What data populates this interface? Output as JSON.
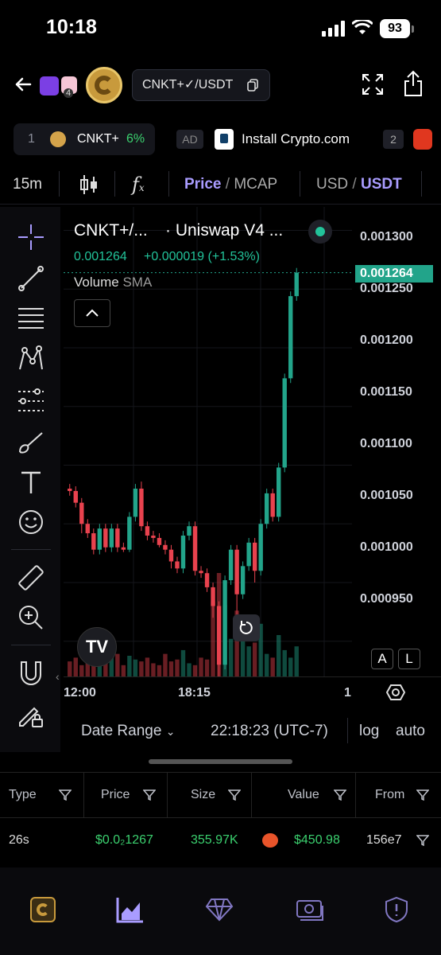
{
  "status": {
    "time": "10:18",
    "battery": "93"
  },
  "header": {
    "pair": "CNKT+✓/USDT",
    "badge_count": "4"
  },
  "tabs": [
    {
      "num": "1",
      "symbol": "CNKT+",
      "pct": "6%"
    },
    {
      "ad": "AD",
      "text": "Install Crypto.com"
    },
    {
      "num": "2"
    }
  ],
  "toolbar": {
    "interval": "15m",
    "price": "Price",
    "slash1": " / ",
    "mcap": "MCAP",
    "usd": "USD",
    "slash2": " / ",
    "usdt": "USDT"
  },
  "chart": {
    "title": "CNKT+/...",
    "exchange": "· Uniswap V4 ...",
    "quote": "0.001264",
    "change": "+0.000019 (+1.53%)",
    "volume_label": "Volume",
    "sma_label": "SMA",
    "current_price": "0.001264",
    "price_ticks": [
      "0.001300",
      "0.001250",
      "0.001200",
      "0.001150",
      "0.001100",
      "0.001050",
      "0.001000",
      "0.000950"
    ],
    "time_ticks": [
      "12:00",
      "18:15",
      "1"
    ],
    "btn_a": "A",
    "btn_l": "L"
  },
  "chart_data": {
    "type": "candlestick",
    "candles": [
      [
        0.00108,
        0.001078,
        0.001084,
        0.001074
      ],
      [
        0.001078,
        0.001068,
        0.001082,
        0.001064
      ],
      [
        0.001068,
        0.00105,
        0.001072,
        0.001042
      ],
      [
        0.00105,
        0.001042,
        0.001054,
        0.001038
      ],
      [
        0.001042,
        0.001028,
        0.001046,
        0.001024
      ],
      [
        0.001028,
        0.001046,
        0.00105,
        0.001024
      ],
      [
        0.001046,
        0.00103,
        0.00105,
        0.001026
      ],
      [
        0.00103,
        0.001046,
        0.00105,
        0.001026
      ],
      [
        0.001046,
        0.00103,
        0.00105,
        0.001026
      ],
      [
        0.00103,
        0.001028,
        0.001034,
        0.001026
      ],
      [
        0.001028,
        0.001056,
        0.00106,
        0.001026
      ],
      [
        0.001056,
        0.00108,
        0.001084,
        0.001052
      ],
      [
        0.00108,
        0.001048,
        0.001086,
        0.001044
      ],
      [
        0.001048,
        0.00104,
        0.001052,
        0.001036
      ],
      [
        0.00104,
        0.001038,
        0.001044,
        0.001034
      ],
      [
        0.001038,
        0.001032,
        0.001042,
        0.00103
      ],
      [
        0.001032,
        0.001028,
        0.001036,
        0.001024
      ],
      [
        0.001028,
        0.001018,
        0.001032,
        0.001012
      ],
      [
        0.001018,
        0.001012,
        0.001022,
        0.001008
      ],
      [
        0.001012,
        0.00104,
        0.001044,
        0.001008
      ],
      [
        0.00104,
        0.001048,
        0.001052,
        0.001036
      ],
      [
        0.001048,
        0.00101,
        0.001052,
        0.001006
      ],
      [
        0.00101,
        0.001008,
        0.001014,
        0.001004
      ],
      [
        0.001008,
        0.000996,
        0.001012,
        0.000992
      ],
      [
        0.000996,
        0.00098,
        0.001,
        0.00097
      ],
      [
        0.00098,
        0.00093,
        0.000984,
        0.00092
      ],
      [
        0.00093,
        0.001002,
        0.001006,
        0.000926
      ],
      [
        0.001002,
        0.001028,
        0.001032,
        0.000998
      ],
      [
        0.001028,
        0.00099,
        0.001032,
        0.00096
      ],
      [
        0.00099,
        0.001014,
        0.001018,
        0.000986
      ],
      [
        0.001014,
        0.001034,
        0.001038,
        0.00101
      ],
      [
        0.001034,
        0.00101,
        0.001038,
        0.001
      ],
      [
        0.00101,
        0.00105,
        0.001054,
        0.001006
      ],
      [
        0.00105,
        0.001076,
        0.00108,
        0.001046
      ],
      [
        0.001076,
        0.001056,
        0.00108,
        0.001052
      ],
      [
        0.001056,
        0.001098,
        0.001102,
        0.001052
      ],
      [
        0.001098,
        0.001174,
        0.001178,
        0.001094
      ],
      [
        0.001174,
        0.001244,
        0.001248,
        0.00117
      ],
      [
        0.001244,
        0.001264,
        0.001268,
        0.00124
      ]
    ],
    "volumes": [
      8,
      10,
      6,
      12,
      9,
      14,
      7,
      10,
      12,
      6,
      11,
      9,
      8,
      10,
      7,
      6,
      12,
      8,
      9,
      14,
      7,
      6,
      10,
      9,
      40,
      55,
      38,
      20,
      35,
      24,
      16,
      18,
      28,
      12,
      10,
      22,
      14,
      10,
      16
    ],
    "ylim": [
      0.00092,
      0.00132
    ],
    "colors": {
      "up": "#22a48a",
      "down": "#e8424e"
    }
  },
  "footer_bar": {
    "date_range": "Date Range",
    "time": "22:18:23 (UTC-7)",
    "log": "log",
    "auto": "auto"
  },
  "table": {
    "headers": [
      "Type",
      "Price",
      "Size",
      "Value",
      "From"
    ],
    "row": {
      "type": "26s",
      "price": "$0.0₂1267",
      "size": "355.97K",
      "value": "$450.98",
      "from": "156e7"
    }
  }
}
